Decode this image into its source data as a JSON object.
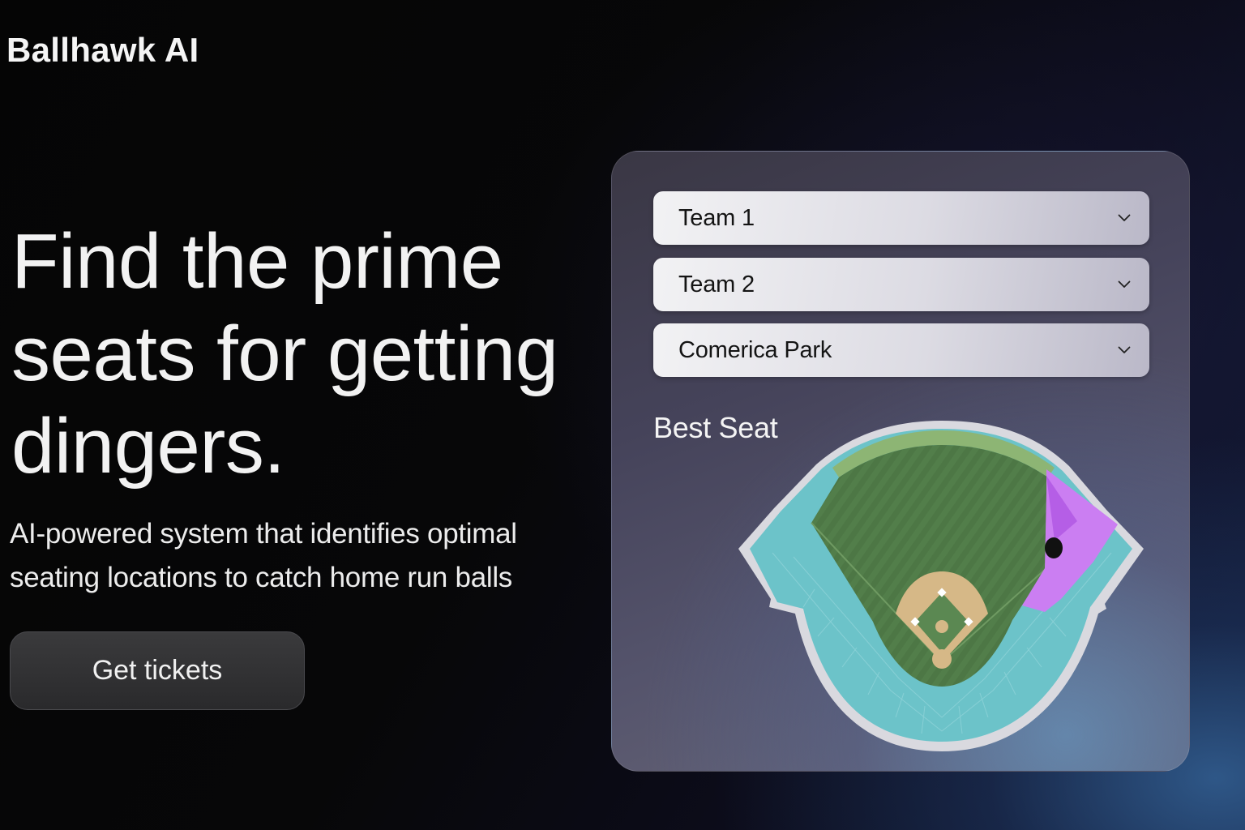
{
  "brand": {
    "name": "Ballhawk AI"
  },
  "hero": {
    "headline": "Find the prime seats for getting dingers.",
    "subtitle": "AI-powered system that identifies optimal seating locations to catch home run balls",
    "cta_label": "Get tickets"
  },
  "panel": {
    "selects": [
      {
        "value": "Team 1"
      },
      {
        "value": "Team 2"
      },
      {
        "value": "Comerica Park"
      }
    ],
    "result_heading": "Best Seat"
  },
  "colors": {
    "background": "#060607",
    "seating": "#6cc3c9",
    "grass": "#527e4a",
    "infield_dirt": "#d6b887",
    "best_seat_zone": "#cb7ef2",
    "seat_marker": "#111111"
  },
  "icons": {
    "dropdown": "chevron-down-icon",
    "seat_marker": "seat-marker-icon"
  }
}
